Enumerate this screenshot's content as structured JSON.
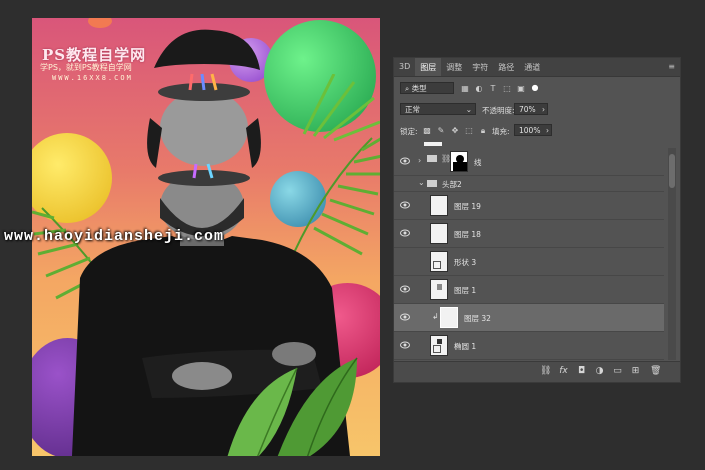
{
  "poster": {
    "watermark_title": "PS教程自学网",
    "watermark_subtitle": "学PS，就到PS教程自学网",
    "watermark_site": "WWW.16XX8.COM"
  },
  "overlay_url": "www.haoyidiansheji.com",
  "panel": {
    "tabs": [
      {
        "label": "3D",
        "active": false
      },
      {
        "label": "图层",
        "active": true
      },
      {
        "label": "调整",
        "active": false
      },
      {
        "label": "字符",
        "active": false
      },
      {
        "label": "路径",
        "active": false
      },
      {
        "label": "通道",
        "active": false
      }
    ],
    "filter_kind": "类型",
    "blend_mode": "正常",
    "opacity_label": "不透明度:",
    "opacity_value": "70%",
    "lock_label": "锁定:",
    "fill_label": "填充:",
    "fill_value": "100%",
    "layers": [
      {
        "name": "线",
        "type": "group-collapsed"
      },
      {
        "name": "头部2",
        "type": "group-expanded"
      },
      {
        "name": "图层 19",
        "type": "layer"
      },
      {
        "name": "图层 18",
        "type": "layer"
      },
      {
        "name": "形状 3",
        "type": "shape"
      },
      {
        "name": "图层 1",
        "type": "layer"
      },
      {
        "name": "图层 32",
        "type": "clipped",
        "selected": true
      },
      {
        "name": "椭圆 1",
        "type": "shape"
      }
    ]
  },
  "colors": {
    "app_bg": "#2e2e2e",
    "panel_bg": "#535353",
    "selected_layer": "#6a6a6a"
  }
}
